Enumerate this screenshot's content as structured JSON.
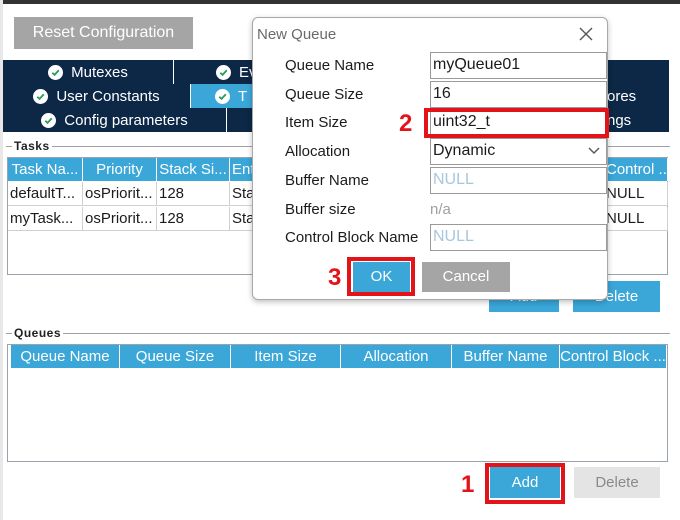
{
  "toolbar": {
    "reset_label": "Reset Configuration"
  },
  "tabs_row1": [
    "Mutexes",
    "Ev",
    "",
    ""
  ],
  "tabs_row2": [
    "User Constants",
    "T",
    "",
    "ores"
  ],
  "tabs_row3": [
    "Config parameters",
    "",
    "ngs"
  ],
  "tasks": {
    "group_label": "Tasks",
    "columns": [
      "Task Na...",
      "Priority",
      "Stack Si...",
      "Ent",
      "Control ..."
    ],
    "rows": [
      [
        "defaultT...",
        "osPriorit...",
        "128",
        "Sta",
        "NULL"
      ],
      [
        "myTask...",
        "osPriorit...",
        "128",
        "Sta",
        "NULL"
      ]
    ],
    "add_label": "Add",
    "delete_label": "Delete"
  },
  "queues": {
    "group_label": "Queues",
    "columns": [
      "Queue Name",
      "Queue Size",
      "Item Size",
      "Allocation",
      "Buffer Name",
      "Control Block ..."
    ],
    "add_label": "Add",
    "delete_label": "Delete"
  },
  "dialog": {
    "title": "New Queue",
    "fields": {
      "queue_name": {
        "label": "Queue Name",
        "value": "myQueue01"
      },
      "queue_size": {
        "label": "Queue Size",
        "value": "16"
      },
      "item_size": {
        "label": "Item Size",
        "value": "uint32_t"
      },
      "allocation": {
        "label": "Allocation",
        "value": "Dynamic"
      },
      "buffer_name": {
        "label": "Buffer Name",
        "placeholder": "NULL"
      },
      "buffer_size": {
        "label": "Buffer size",
        "value": "n/a"
      },
      "control_block": {
        "label": "Control Block Name",
        "placeholder": "NULL"
      }
    },
    "ok_label": "OK",
    "cancel_label": "Cancel"
  },
  "annotations": {
    "step1": "1",
    "step2": "2",
    "step3": "3"
  },
  "colors": {
    "accent": "#3aa7d8",
    "nav": "#0c2846",
    "highlight": "#e3131a",
    "disabled": "#e4e4e4"
  }
}
